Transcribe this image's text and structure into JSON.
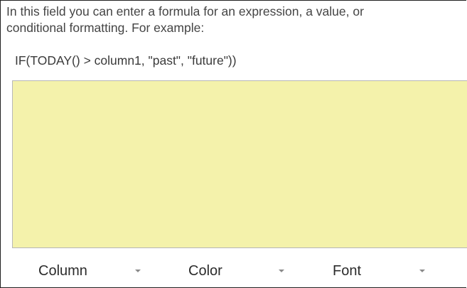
{
  "help": {
    "line1": "In this field you can enter a formula for an expression, a value, or",
    "line2": "conditional formatting. For example:"
  },
  "example_formula": "IF(TODAY() > column1, \"past\", \"future\"))",
  "editor": {
    "value": "",
    "background_color": "#f4f2ab"
  },
  "toolbar": {
    "column_label": "Column",
    "color_label": "Color",
    "font_label": "Font",
    "caret_icon": "chevron-down-icon"
  }
}
